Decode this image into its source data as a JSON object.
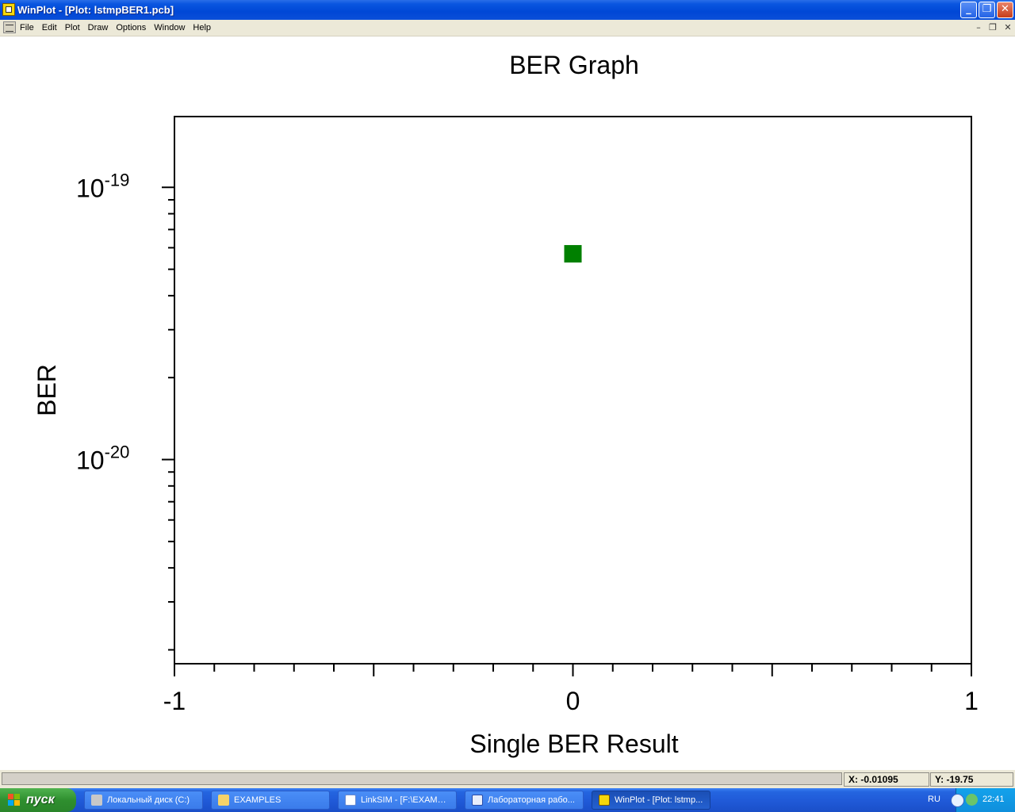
{
  "window": {
    "title": "WinPlot - [Plot: lstmpBER1.pcb]",
    "minimize_glyph": "_",
    "restore_glyph": "❐",
    "close_glyph": "✕"
  },
  "menu": {
    "items": [
      "File",
      "Edit",
      "Plot",
      "Draw",
      "Options",
      "Window",
      "Help"
    ],
    "mdi_minimize_glyph": "–",
    "mdi_restore_glyph": "❐",
    "mdi_close_glyph": "✕"
  },
  "chart_data": {
    "type": "scatter",
    "title": "BER Graph",
    "xlabel": "Single BER Result",
    "ylabel": "BER",
    "xlim": [
      -1,
      1
    ],
    "ylim_log10": [
      -20.75,
      -18.74
    ],
    "yscale": "log",
    "x_tick_labels": [
      "-1",
      "0",
      "1"
    ],
    "x_ticks": [
      -1,
      0,
      1
    ],
    "y_tick_labels": [
      {
        "base": "10",
        "exp": "-19",
        "value_log10": -19
      },
      {
        "base": "10",
        "exp": "-20",
        "value_log10": -20
      }
    ],
    "series": [
      {
        "x": [
          0
        ],
        "y": [
          5.7e-20
        ],
        "marker": "square",
        "color": "#008000"
      }
    ],
    "grid": false
  },
  "status": {
    "x_readout": "X: -0.01095",
    "y_readout": "Y: -19.75"
  },
  "taskbar": {
    "start_label": "пуск",
    "tasks": [
      {
        "label": "Локальный диск (C:)",
        "icon": "drive-icon",
        "active": false
      },
      {
        "label": "EXAMPLES",
        "icon": "folder-icon",
        "active": false
      },
      {
        "label": "LinkSIM - [F:\\EXAMPL...",
        "icon": "app-window-icon",
        "active": false
      },
      {
        "label": "Лабораторная рабо...",
        "icon": "word-document-icon",
        "active": false
      },
      {
        "label": "WinPlot - [Plot: lstmp...",
        "icon": "winplot-icon",
        "active": true
      }
    ],
    "language": "RU",
    "clock": "22:41"
  },
  "colors": {
    "titlebar": "#0047d6",
    "menubar": "#ece9d8",
    "marker": "#008000",
    "taskbar": "#245edb",
    "start": "#3c9a3c",
    "tray": "#13a2ec"
  }
}
